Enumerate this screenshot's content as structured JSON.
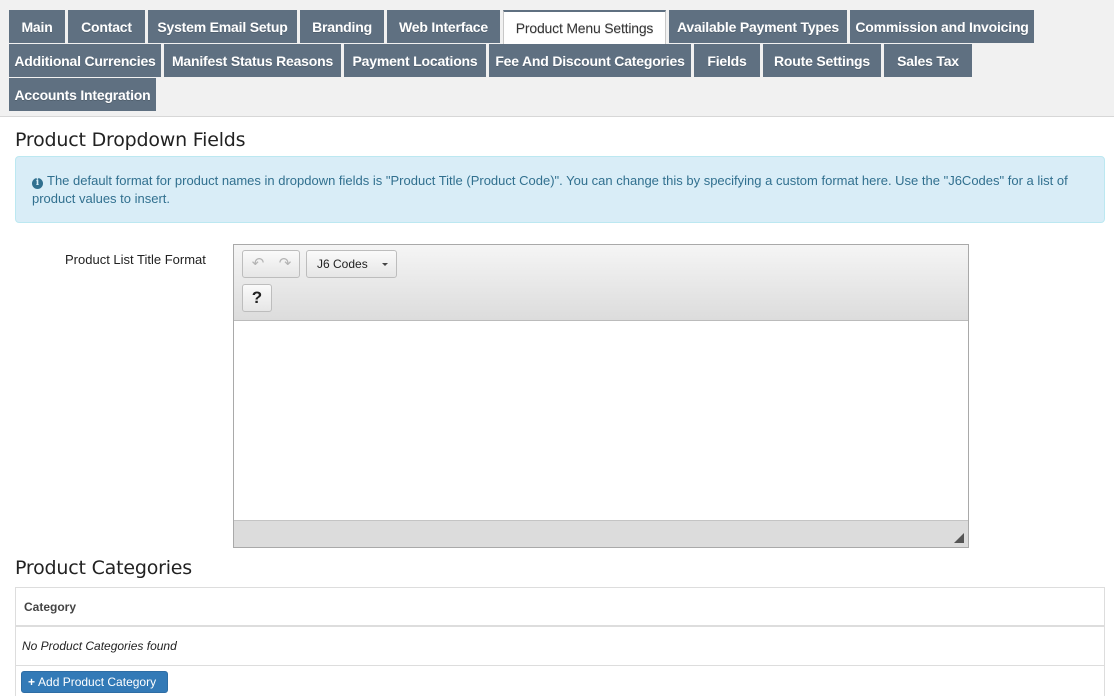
{
  "tabs": [
    {
      "label": "Main",
      "active": false
    },
    {
      "label": "Contact",
      "active": false
    },
    {
      "label": "System Email Setup",
      "active": false
    },
    {
      "label": "Branding",
      "active": false
    },
    {
      "label": "Web Interface",
      "active": false
    },
    {
      "label": "Product Menu Settings",
      "active": true
    },
    {
      "label": "Available Payment Types",
      "active": false
    },
    {
      "label": "Commission and Invoicing",
      "active": false
    },
    {
      "label": "Additional Currencies",
      "active": false
    },
    {
      "label": "Manifest Status Reasons",
      "active": false
    },
    {
      "label": "Payment Locations",
      "active": false
    },
    {
      "label": "Fee And Discount Categories",
      "active": false
    },
    {
      "label": "Fields",
      "active": false
    },
    {
      "label": "Route Settings",
      "active": false
    },
    {
      "label": "Sales Tax",
      "active": false
    },
    {
      "label": "Accounts Integration",
      "active": false
    }
  ],
  "dropdown_section": {
    "title": "Product Dropdown Fields",
    "info_text": "The default format for product names in dropdown fields is \"Product Title (Product Code)\". You can change this by specifying a custom format here. Use the \"J6Codes\" for a list of product values to insert.",
    "field_label": "Product List Title Format",
    "editor": {
      "undo_icon": "undo-arrow-icon",
      "redo_icon": "redo-arrow-icon",
      "codes_dropdown_label": "J6 Codes",
      "help_label": "?",
      "content": ""
    }
  },
  "categories_section": {
    "title": "Product Categories",
    "column_header": "Category",
    "empty_message": "No Product Categories found",
    "add_button_label": "Add Product Category"
  },
  "colors": {
    "tab_bg": "#5f7081",
    "alert_bg": "#d9edf7",
    "alert_text": "#31708f",
    "primary_button": "#337ab7"
  }
}
